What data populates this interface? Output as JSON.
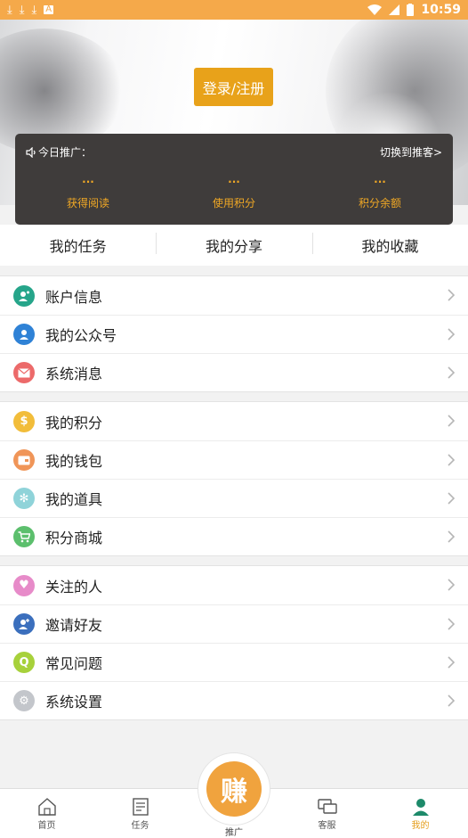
{
  "status_bar": {
    "time": "10:59",
    "icons_left": [
      "download-icon",
      "download-icon",
      "download-icon",
      "app-icon"
    ],
    "icons_right": [
      "wifi-icon",
      "signal-icon",
      "battery-icon"
    ]
  },
  "header": {
    "login_label": "登录/注册"
  },
  "promo": {
    "title": "今日推广：",
    "switch_label": "切换到推客>",
    "stats": [
      {
        "value": "···",
        "label": "获得阅读"
      },
      {
        "value": "···",
        "label": "使用积分"
      },
      {
        "value": "···",
        "label": "积分余额"
      }
    ]
  },
  "tabs": [
    "我的任务",
    "我的分享",
    "我的收藏"
  ],
  "groups": [
    [
      {
        "label": "账户信息",
        "icon": "account-icon",
        "color": "#26a58a"
      },
      {
        "label": "我的公众号",
        "icon": "official-account-icon",
        "color": "#2f82d6"
      },
      {
        "label": "系统消息",
        "icon": "mail-icon",
        "color": "#ec6a6a"
      }
    ],
    [
      {
        "label": "我的积分",
        "icon": "points-icon",
        "color": "#f2bd3a"
      },
      {
        "label": "我的钱包",
        "icon": "wallet-icon",
        "color": "#f09558"
      },
      {
        "label": "我的道具",
        "icon": "props-icon",
        "color": "#8fd3d9"
      },
      {
        "label": "积分商城",
        "icon": "cart-icon",
        "color": "#5cbf6d"
      }
    ],
    [
      {
        "label": "关注的人",
        "icon": "heart-icon",
        "color": "#e78bc9"
      },
      {
        "label": "邀请好友",
        "icon": "invite-icon",
        "color": "#3b6fbd"
      },
      {
        "label": "常见问题",
        "icon": "faq-icon",
        "color": "#a7d13b"
      },
      {
        "label": "系统设置",
        "icon": "settings-icon",
        "color": "#c3c6cb"
      }
    ]
  ],
  "bottom_nav": {
    "items": [
      {
        "label": "首页",
        "icon": "home-icon"
      },
      {
        "label": "任务",
        "icon": "task-icon"
      },
      {
        "label": "客服",
        "icon": "service-icon"
      },
      {
        "label": "我的",
        "icon": "profile-icon"
      }
    ],
    "center_glyph": "赚",
    "center_label": "推广",
    "accent": "#e59e1c"
  }
}
